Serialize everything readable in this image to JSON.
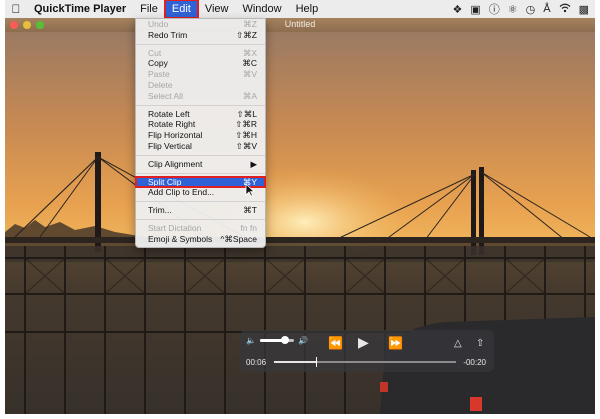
{
  "menubar": {
    "apple_icon": "apple-logo",
    "app_name": "QuickTime Player",
    "menus": [
      "File",
      "Edit",
      "View",
      "Window",
      "Help"
    ],
    "active_menu": "Edit"
  },
  "window": {
    "title": "Untitled"
  },
  "edit_menu": {
    "items": [
      {
        "label": "Undo",
        "shortcut": "⌘Z",
        "enabled": false
      },
      {
        "label": "Redo Trim",
        "shortcut": "⇧⌘Z",
        "enabled": true
      },
      {
        "label": "Cut",
        "shortcut": "⌘X",
        "enabled": false
      },
      {
        "label": "Copy",
        "shortcut": "⌘C",
        "enabled": true
      },
      {
        "label": "Paste",
        "shortcut": "⌘V",
        "enabled": false
      },
      {
        "label": "Delete",
        "shortcut": "",
        "enabled": false
      },
      {
        "label": "Select All",
        "shortcut": "⌘A",
        "enabled": false
      },
      {
        "label": "Rotate Left",
        "shortcut": "⇧⌘L",
        "enabled": true
      },
      {
        "label": "Rotate Right",
        "shortcut": "⇧⌘R",
        "enabled": true
      },
      {
        "label": "Flip Horizontal",
        "shortcut": "⇧⌘H",
        "enabled": true
      },
      {
        "label": "Flip Vertical",
        "shortcut": "⇧⌘V",
        "enabled": true
      },
      {
        "label": "Clip Alignment",
        "shortcut": "▶",
        "enabled": true
      },
      {
        "label": "Split Clip",
        "shortcut": "⌘Y",
        "enabled": true,
        "highlighted": true
      },
      {
        "label": "Add Clip to End...",
        "shortcut": "",
        "enabled": true
      },
      {
        "label": "Trim...",
        "shortcut": "⌘T",
        "enabled": true
      },
      {
        "label": "Start Dictation",
        "shortcut": "fn fn",
        "enabled": false
      },
      {
        "label": "Emoji & Symbols",
        "shortcut": "^⌘Space",
        "enabled": true
      }
    ]
  },
  "controller": {
    "current_time": "00:06",
    "remaining_time": "-00:20",
    "volume_level": 0.75,
    "progress": 0.23
  },
  "colors": {
    "highlight": "#2f62d6",
    "annotation": "#e02020"
  }
}
